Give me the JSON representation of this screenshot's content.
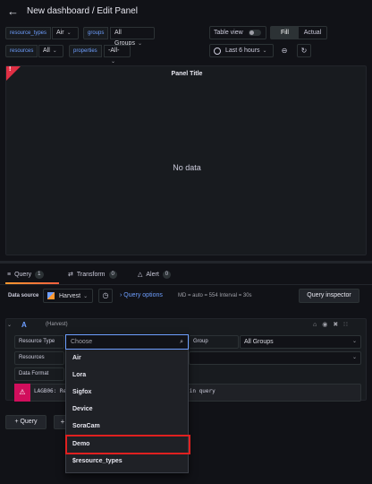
{
  "header": {
    "title": "New dashboard / Edit Panel"
  },
  "variables": [
    {
      "label": "resource_types",
      "value": "Air"
    },
    {
      "label": "groups",
      "value": "All Groups"
    },
    {
      "label": "resources",
      "value": "All"
    },
    {
      "label": "properties",
      "value": "-All-"
    }
  ],
  "toolbar": {
    "table_view_label": "Table view",
    "fill_label": "Fill",
    "actual_label": "Actual",
    "time_range": "Last 6 hours"
  },
  "panel": {
    "title": "Panel Title",
    "corner_mark": "!",
    "empty_text": "No data"
  },
  "tabs": [
    {
      "label": "Query",
      "count": "1"
    },
    {
      "label": "Transform",
      "count": "0"
    },
    {
      "label": "Alert",
      "count": "0"
    }
  ],
  "datasource": {
    "label": "Data source",
    "name": "Harvest",
    "query_options_label": "Query options",
    "query_options_meta": "MD = auto = 554    Interval = 30s",
    "inspector_label": "Query inspector"
  },
  "query": {
    "letter": "A",
    "datasource_hint": "(Harvest)",
    "fields": {
      "resource_type_label": "Resource Type",
      "group_label": "Group",
      "group_value": "All Groups",
      "resources_label": "Resources",
      "data_format_label": "Data Format"
    },
    "warning_text_left": "LAGB06: Re",
    "warning_text_right": "ified in query",
    "add_query_label": "+ Query",
    "add_expression_label": "+"
  },
  "dropdown": {
    "search_placeholder": "Choose",
    "options": [
      "Air",
      "Lora",
      "Sigfox",
      "Device",
      "SoraCam",
      "Demo",
      "$resource_types"
    ],
    "highlighted": "Demo"
  },
  "colors": {
    "background": "#111217",
    "panel": "#181b1f",
    "accent_blue": "#6e9fff",
    "error_red": "#e02f44",
    "highlight_box": "#e02020"
  }
}
